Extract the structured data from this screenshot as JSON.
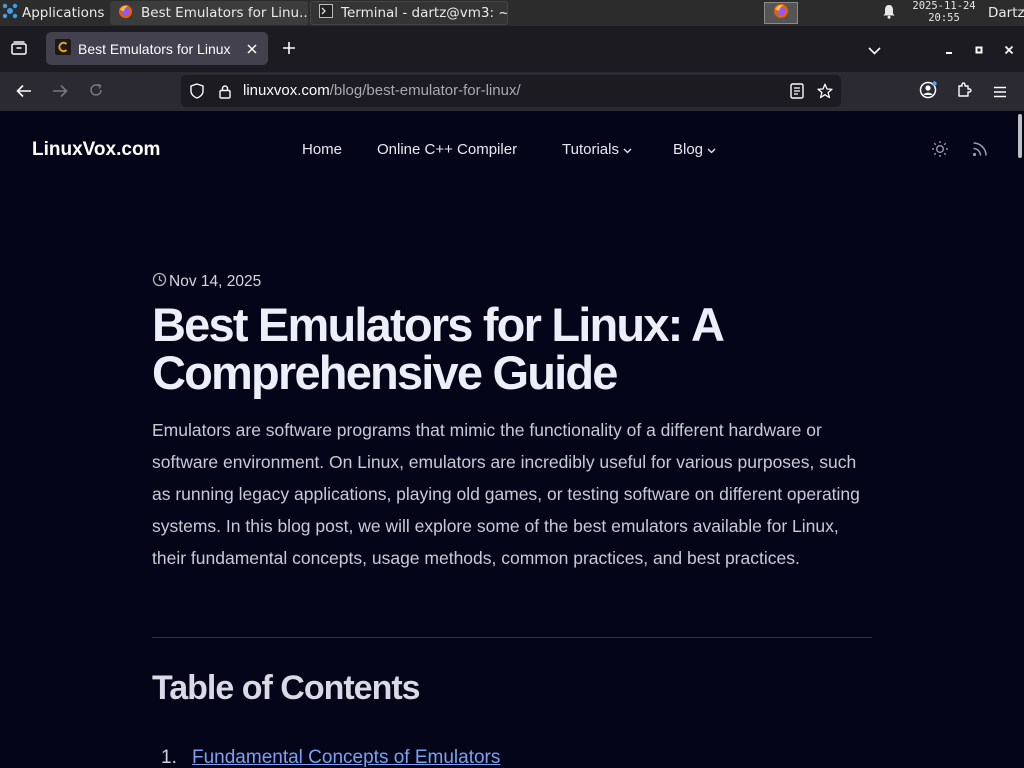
{
  "taskbar": {
    "apps_label": "Applications",
    "window_buttons": [
      {
        "label": "Best Emulators for Linu..."
      },
      {
        "label": "Terminal - dartz@vm3: ~"
      }
    ],
    "clock_date": "2025-11-24",
    "clock_time": "20:55",
    "user": "Dartz"
  },
  "browser": {
    "tab_title": "Best Emulators for Linux",
    "url_domain": "linuxvox.com",
    "url_path": "/blog/best-emulator-for-linux/"
  },
  "site": {
    "logo": "LinuxVox.com",
    "nav": [
      {
        "label": "Home"
      },
      {
        "label": "Online C++ Compiler"
      },
      {
        "label": "Tutorials"
      },
      {
        "label": "Blog"
      }
    ]
  },
  "article": {
    "date": "Nov 14, 2025",
    "title": "Best Emulators for Linux: A Comprehensive Guide",
    "intro": "Emulators are software programs that mimic the functionality of a different hardware or software environment. On Linux, emulators are incredibly useful for various purposes, such as running legacy applications, playing old games, or testing software on different operating systems. In this blog post, we will explore some of the best emulators available for Linux, their fundamental concepts, usage methods, common practices, and best practices.",
    "toc_title": "Table of Contents",
    "toc": [
      {
        "num": "1.",
        "label": "Fundamental Concepts of Emulators"
      }
    ]
  },
  "colors": {
    "page_bg": "#050519",
    "taskbar_bg": "#2c2c2c",
    "tabstrip_bg": "#1c1b22",
    "navbar_bg": "#2b2a33",
    "link": "#7aa2f0"
  },
  "icons": [
    "applications-icon",
    "firefox-icon",
    "terminal-icon",
    "bell-icon",
    "list-all-tabs-icon",
    "site-favicon",
    "close-icon",
    "plus-icon",
    "chevron-down-icon",
    "minimize-icon",
    "maximize-icon",
    "window-close-icon",
    "back-arrow-icon",
    "forward-arrow-icon",
    "reload-icon",
    "shield-icon",
    "lock-icon",
    "reader-view-icon",
    "star-icon",
    "account-icon",
    "extensions-icon",
    "menu-icon",
    "sun-icon",
    "rss-icon",
    "clock-icon"
  ]
}
